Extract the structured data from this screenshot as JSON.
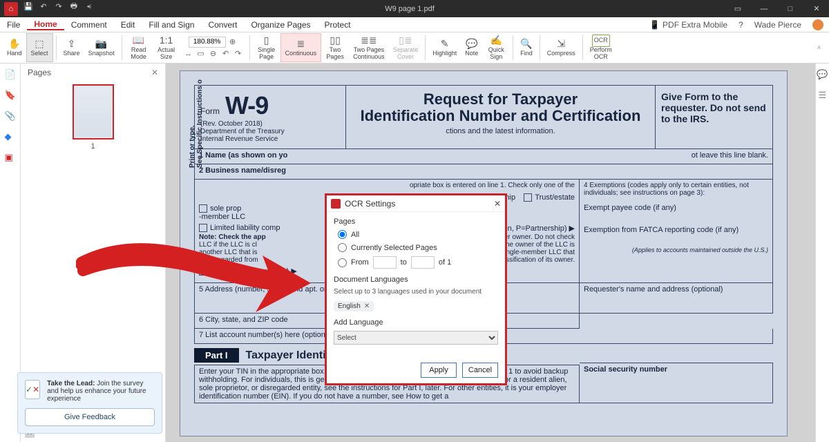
{
  "titlebar": {
    "title": "W9 page 1.pdf"
  },
  "menu": {
    "items": [
      "File",
      "Home",
      "Comment",
      "Edit",
      "Fill and Sign",
      "Convert",
      "Organize Pages",
      "Protect"
    ],
    "active": "Home",
    "mobile": "PDF Extra Mobile",
    "user": "Wade Pierce"
  },
  "ribbon": {
    "hand": "Hand",
    "select": "Select",
    "share": "Share",
    "snapshot": "Snapshot",
    "readmode": "Read\nMode",
    "actual": "Actual\nSize",
    "zoom": "180.88%",
    "single": "Single\nPage",
    "continuous": "Continuous",
    "twopages": "Two\nPages",
    "twocont": "Two Pages\nContinuous",
    "sepcover": "Separate\nCover",
    "highlight": "Highlight",
    "note": "Note",
    "quicksign": "Quick\nSign",
    "find": "Find",
    "compress": "Compress",
    "ocr": "Perform\nOCR"
  },
  "pages": {
    "title": "Pages",
    "current": "1"
  },
  "doc": {
    "form": "Form",
    "title": "W-9",
    "rev": "(Rev. October 2018)",
    "dept": "Department of the Treasury\nInternal Revenue Service",
    "request": "Request for Taxpayer\nIdentification Number and Certification",
    "goto": "ctions and the latest information.",
    "giveform": "Give Form to the requester. Do not send to the IRS.",
    "line1": "1  Name (as shown on yo",
    "line1b": "ot leave this line blank.",
    "line2": "2  Business name/disreg",
    "line3a": "opriate box",
    "line3b": "is entered on line 1. Check only one of the",
    "partnership": "Partnership",
    "trust": "Trust/estate",
    "llc1": "sole prop",
    "llc2": "-member LLC",
    "llc": "Limited liability comp",
    "llc_tail": "corporation, P=Partnership) ▶",
    "note": "Note: Check the app",
    "note2": "LLC if the LLC is cl",
    "note3": "another LLC that is",
    "note4": "is disregarded from",
    "note_tail1": "f the single-member owner.  Do not check",
    "note_tail2": "the owner unless the owner of the LLC is",
    "note_tail3": "oses. Otherwise, a single-member LLC that",
    "note_tail4": "classification of its owner.",
    "other": "Other (see instructions) ▶",
    "exempt_hdr": "4  Exemptions (codes apply only to certain entities, not individuals; see instructions on page 3):",
    "exempt_payee": "Exempt payee code (if any)",
    "exempt_fatca": "Exemption from FATCA reporting code (if any)",
    "exempt_note": "(Applies to accounts maintained outside the U.S.)",
    "addr": "5  Address (number, street, and apt. or suite no.) See instructions.",
    "reqname": "Requester's name and address (optional)",
    "city": "6  City, state, and ZIP code",
    "acct": "7  List account number(s) here (optional)",
    "vert": "Print or type.\nSee Specific Instructions o",
    "part1": "Part I",
    "part1t": "Taxpayer Identification Number (TIN)",
    "tin_body": "Enter your TIN in the appropriate box. The TIN provided must match the name given on line 1 to avoid backup withholding. For individuals, this is generally your social security number (SSN). However, for a resident alien, sole proprietor, or disregarded entity, see the instructions for Part I, later. For other entities, it is your employer identification number (EIN). If you do not have a number, see How to get a",
    "ssn": "Social security number"
  },
  "dialog": {
    "title": "OCR Settings",
    "pages": "Pages",
    "all": "All",
    "currently": "Currently Selected Pages",
    "from": "From",
    "to": "to",
    "of": "of 1",
    "langs": "Document Languages",
    "hint": "Select up to 3 languages used in your document",
    "english": "English",
    "addlang": "Add Language",
    "select": "Select",
    "apply": "Apply",
    "cancel": "Cancel"
  },
  "feedback": {
    "title": "Take the Lead:",
    "body": "Join the survey and help us enhance your future experience",
    "btn": "Give Feedback"
  }
}
